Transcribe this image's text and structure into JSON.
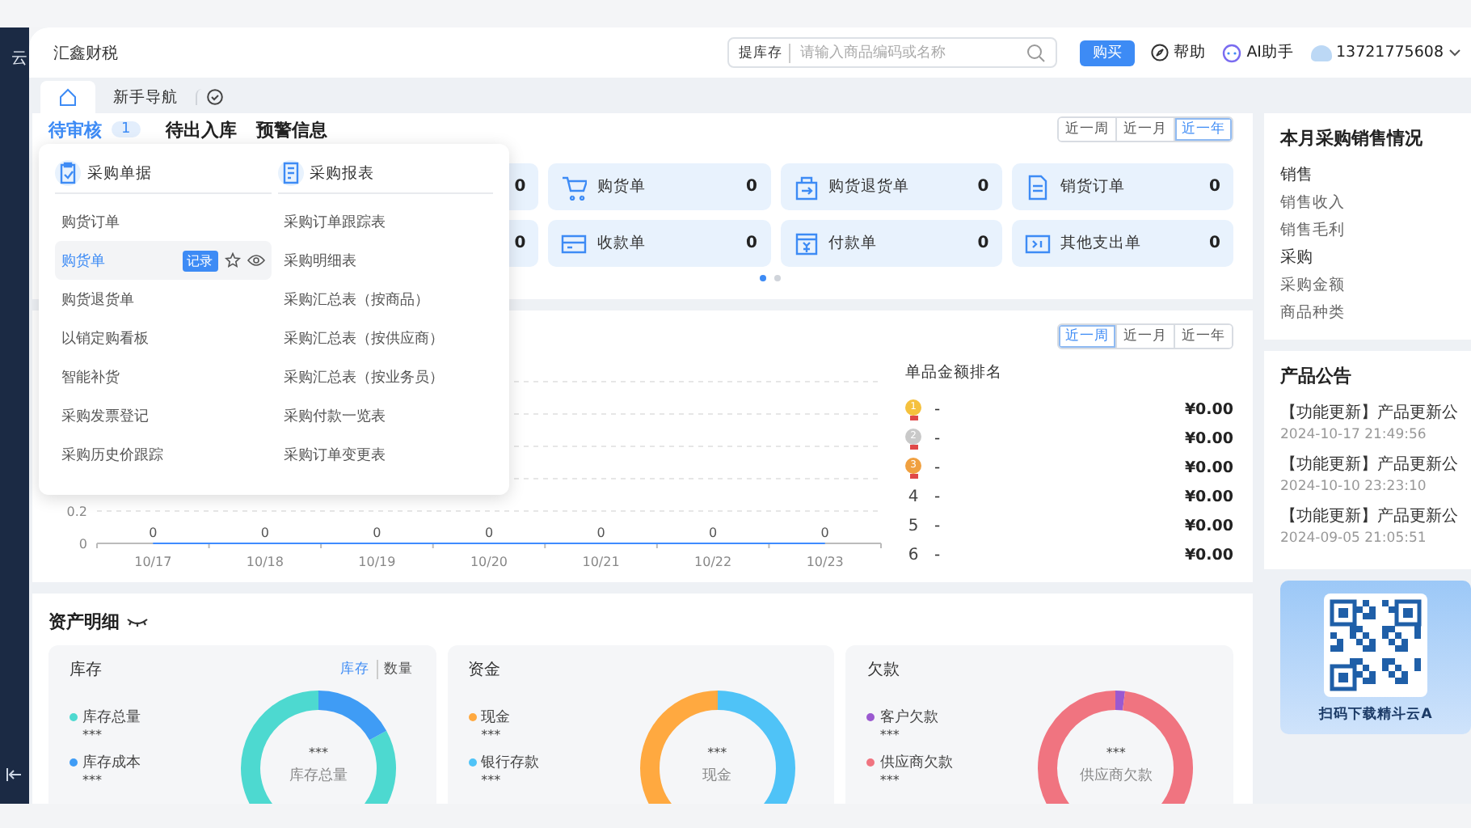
{
  "sidebar": {
    "text": "云"
  },
  "header": {
    "company": "汇鑫财税",
    "search": {
      "scope": "提库存",
      "placeholder": "请输入商品编码或名称"
    },
    "buy_button": "购买",
    "help": "帮助",
    "ai": "AI助手",
    "user": "13721775608"
  },
  "nav_tabs": [
    {
      "kind": "home",
      "selected": true
    },
    {
      "kind": "text",
      "label": "新手导航",
      "selected": false
    },
    {
      "kind": "history",
      "selected": false
    }
  ],
  "todo": {
    "tabs": [
      {
        "label": "待审核",
        "badge": "1",
        "selected": true
      },
      {
        "label": "待出入库",
        "selected": false
      },
      {
        "label": "预警信息",
        "selected": false
      }
    ],
    "periods": [
      {
        "label": "近一周",
        "selected": false
      },
      {
        "label": "近一月",
        "selected": false
      },
      {
        "label": "近一年",
        "selected": true
      }
    ],
    "tiles": [
      {
        "kind": "partial",
        "value": "0"
      },
      {
        "kind": "cart",
        "label": "购货单",
        "value": "0"
      },
      {
        "kind": "return",
        "label": "购货退货单",
        "value": "0"
      },
      {
        "kind": "doc",
        "label": "销货订单",
        "value": "0"
      },
      {
        "kind": "partial",
        "value": "0"
      },
      {
        "kind": "card",
        "label": "收款单",
        "value": "0"
      },
      {
        "kind": "pay",
        "label": "付款单",
        "value": "0"
      },
      {
        "kind": "expense",
        "label": "其他支出单",
        "value": "0"
      }
    ],
    "pages": [
      {
        "selected": true
      },
      {
        "selected": false
      }
    ]
  },
  "trend": {
    "chart_data": {
      "type": "line",
      "categories": [
        "10/17",
        "10/18",
        "10/19",
        "10/20",
        "10/21",
        "10/22",
        "10/23"
      ],
      "series": [
        {
          "color": "#3f8cff",
          "values": [
            0,
            0,
            0,
            0,
            0,
            0,
            0
          ]
        }
      ],
      "ylim": [
        0,
        1
      ],
      "yticks": [
        0,
        0.2
      ],
      "data_labels": true
    },
    "periods": [
      {
        "label": "近一周",
        "selected": true
      },
      {
        "label": "近一月",
        "selected": false
      },
      {
        "label": "近一年",
        "selected": false
      }
    ],
    "ranking": {
      "title": "单品金额排名",
      "rows": [
        {
          "kind": "medal",
          "rank": "1",
          "color": "#f5c13d",
          "name": "-",
          "amount": "¥0.00"
        },
        {
          "kind": "medal",
          "rank": "2",
          "color": "#c9c9c9",
          "name": "-",
          "amount": "¥0.00"
        },
        {
          "kind": "medal",
          "rank": "3",
          "color": "#f0a040",
          "name": "-",
          "amount": "¥0.00"
        },
        {
          "kind": "number",
          "rank": "4",
          "name": "-",
          "amount": "¥0.00"
        },
        {
          "kind": "number",
          "rank": "5",
          "name": "-",
          "amount": "¥0.00"
        },
        {
          "kind": "number",
          "rank": "6",
          "name": "-",
          "amount": "¥0.00"
        }
      ]
    }
  },
  "assets": {
    "title": "资产明细",
    "cards": [
      {
        "title": "库存",
        "toggle": [
          {
            "label": "库存",
            "selected": true
          },
          {
            "label": "数量",
            "selected": false
          }
        ],
        "legend": [
          {
            "label": "库存总量",
            "value": "***",
            "color": "#4dd9d0"
          },
          {
            "label": "库存成本",
            "value": "***",
            "color": "#3f9cf5"
          }
        ],
        "center_value": "***",
        "center_label": "库存总量"
      },
      {
        "title": "资金",
        "legend": [
          {
            "label": "现金",
            "value": "***",
            "color": "#ffa940"
          },
          {
            "label": "银行存款",
            "value": "***",
            "color": "#4fc3f7"
          }
        ],
        "center_value": "***",
        "center_label": "现金"
      },
      {
        "title": "欠款",
        "legend": [
          {
            "label": "客户欠款",
            "value": "***",
            "color": "#9b59d0"
          },
          {
            "label": "供应商欠款",
            "value": "***",
            "color": "#f07480"
          }
        ],
        "center_value": "***",
        "center_label": "供应商欠款"
      }
    ]
  },
  "right": {
    "summary": {
      "title": "本月采购销售情况",
      "groups": [
        {
          "title": "销售",
          "items": [
            "销售收入",
            "销售毛利"
          ]
        },
        {
          "title": "采购",
          "items": [
            "采购金额",
            "商品种类"
          ]
        }
      ]
    },
    "notices": {
      "title": "产品公告",
      "items": [
        {
          "title": "【功能更新】产品更新公",
          "time": "2024-10-17 21:49:56"
        },
        {
          "title": "【功能更新】产品更新公",
          "time": "2024-10-10 23:23:10"
        },
        {
          "title": "【功能更新】产品更新公",
          "time": "2024-09-05 21:05:51"
        }
      ]
    },
    "qr": {
      "caption": "扫码下载精斗云A"
    }
  },
  "popup": {
    "columns": [
      {
        "title": "采购单据",
        "items": [
          {
            "label": "购货订单",
            "highlighted": false
          },
          {
            "label": "购货单",
            "highlighted": true,
            "badge": "记录"
          },
          {
            "label": "购货退货单",
            "highlighted": false
          },
          {
            "label": "以销定购看板",
            "highlighted": false
          },
          {
            "label": "智能补货",
            "highlighted": false
          },
          {
            "label": "采购发票登记",
            "highlighted": false
          },
          {
            "label": "采购历史价跟踪",
            "highlighted": false
          }
        ]
      },
      {
        "title": "采购报表",
        "items": [
          {
            "label": "采购订单跟踪表",
            "highlighted": false
          },
          {
            "label": "采购明细表",
            "highlighted": false
          },
          {
            "label": "采购汇总表（按商品）",
            "highlighted": false
          },
          {
            "label": "采购汇总表（按供应商）",
            "highlighted": false
          },
          {
            "label": "采购汇总表（按业务员）",
            "highlighted": false
          },
          {
            "label": "采购付款一览表",
            "highlighted": false
          },
          {
            "label": "采购订单变更表",
            "highlighted": false
          }
        ]
      }
    ]
  }
}
